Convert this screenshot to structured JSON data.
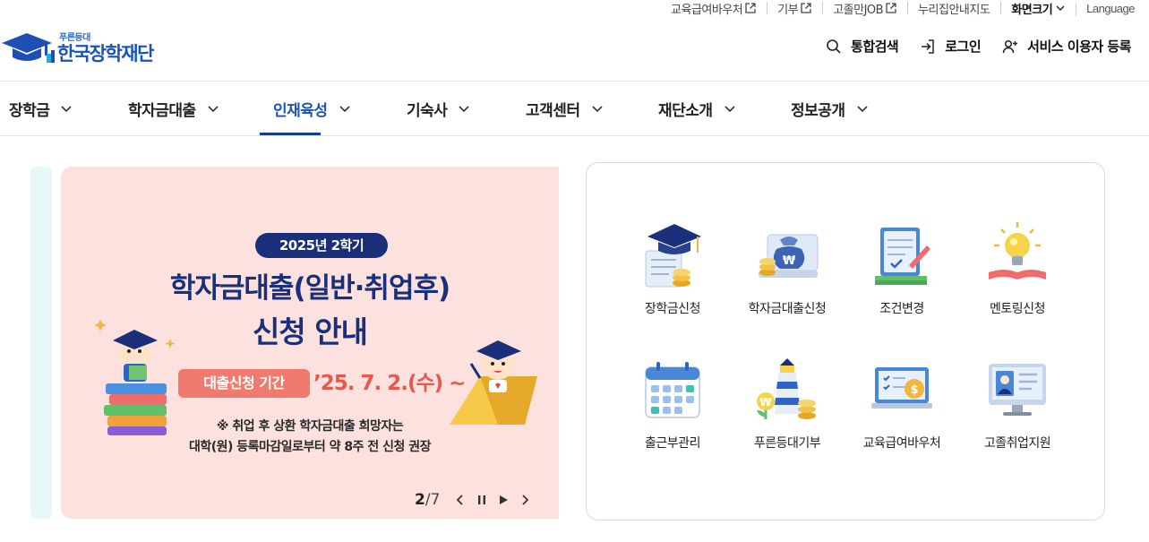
{
  "util_links": [
    {
      "label": "교육급여바우처",
      "external": true
    },
    {
      "label": "기부",
      "external": true
    },
    {
      "label": "고졸만JOB",
      "external": true
    },
    {
      "label": "누리집안내지도",
      "external": false
    },
    {
      "label": "화면크기",
      "dropdown": true
    },
    {
      "label": "Language"
    }
  ],
  "logo": {
    "sub": "푸른등대",
    "main": "한국장학재단"
  },
  "header_actions": {
    "search": "통합검색",
    "login": "로그인",
    "register": "서비스 이용자 등록"
  },
  "gnb": {
    "items": [
      "장학금",
      "학자금대출",
      "인재육성",
      "기숙사",
      "고객센터",
      "재단소개",
      "정보공개"
    ],
    "active": "인재육성"
  },
  "banner": {
    "badge": "2025년 2학기",
    "title_line1": "학자금대출(일반·취업후)",
    "title_line2": "신청 안내",
    "period_label": "대출신청 기간",
    "period_date": "’25. 7. 2.(수) ~",
    "note_line1": "※ 취업 후 상환 학자금대출 희망자는",
    "note_line2": "대학(원) 등록마감일로부터 약 8주 전 신청 권장",
    "pager_current": "2",
    "pager_total": "/7"
  },
  "quick_services": [
    {
      "label": "장학금신청",
      "icon": "graduation-cap-icon"
    },
    {
      "label": "학자금대출신청",
      "icon": "money-bag-icon"
    },
    {
      "label": "조건변경",
      "icon": "document-pen-icon"
    },
    {
      "label": "멘토링신청",
      "icon": "lightbulb-book-icon"
    },
    {
      "label": "출근부관리",
      "icon": "calendar-icon"
    },
    {
      "label": "푸른등대기부",
      "icon": "lighthouse-coins-icon"
    },
    {
      "label": "교육급여바우처",
      "icon": "laptop-checklist-icon"
    },
    {
      "label": "고졸취업지원",
      "icon": "monitor-profile-icon"
    }
  ],
  "colors": {
    "brand": "#1952b8",
    "navy": "#1a2f7a",
    "banner_bg": "#fde1df",
    "accent": "#f07a6e"
  }
}
